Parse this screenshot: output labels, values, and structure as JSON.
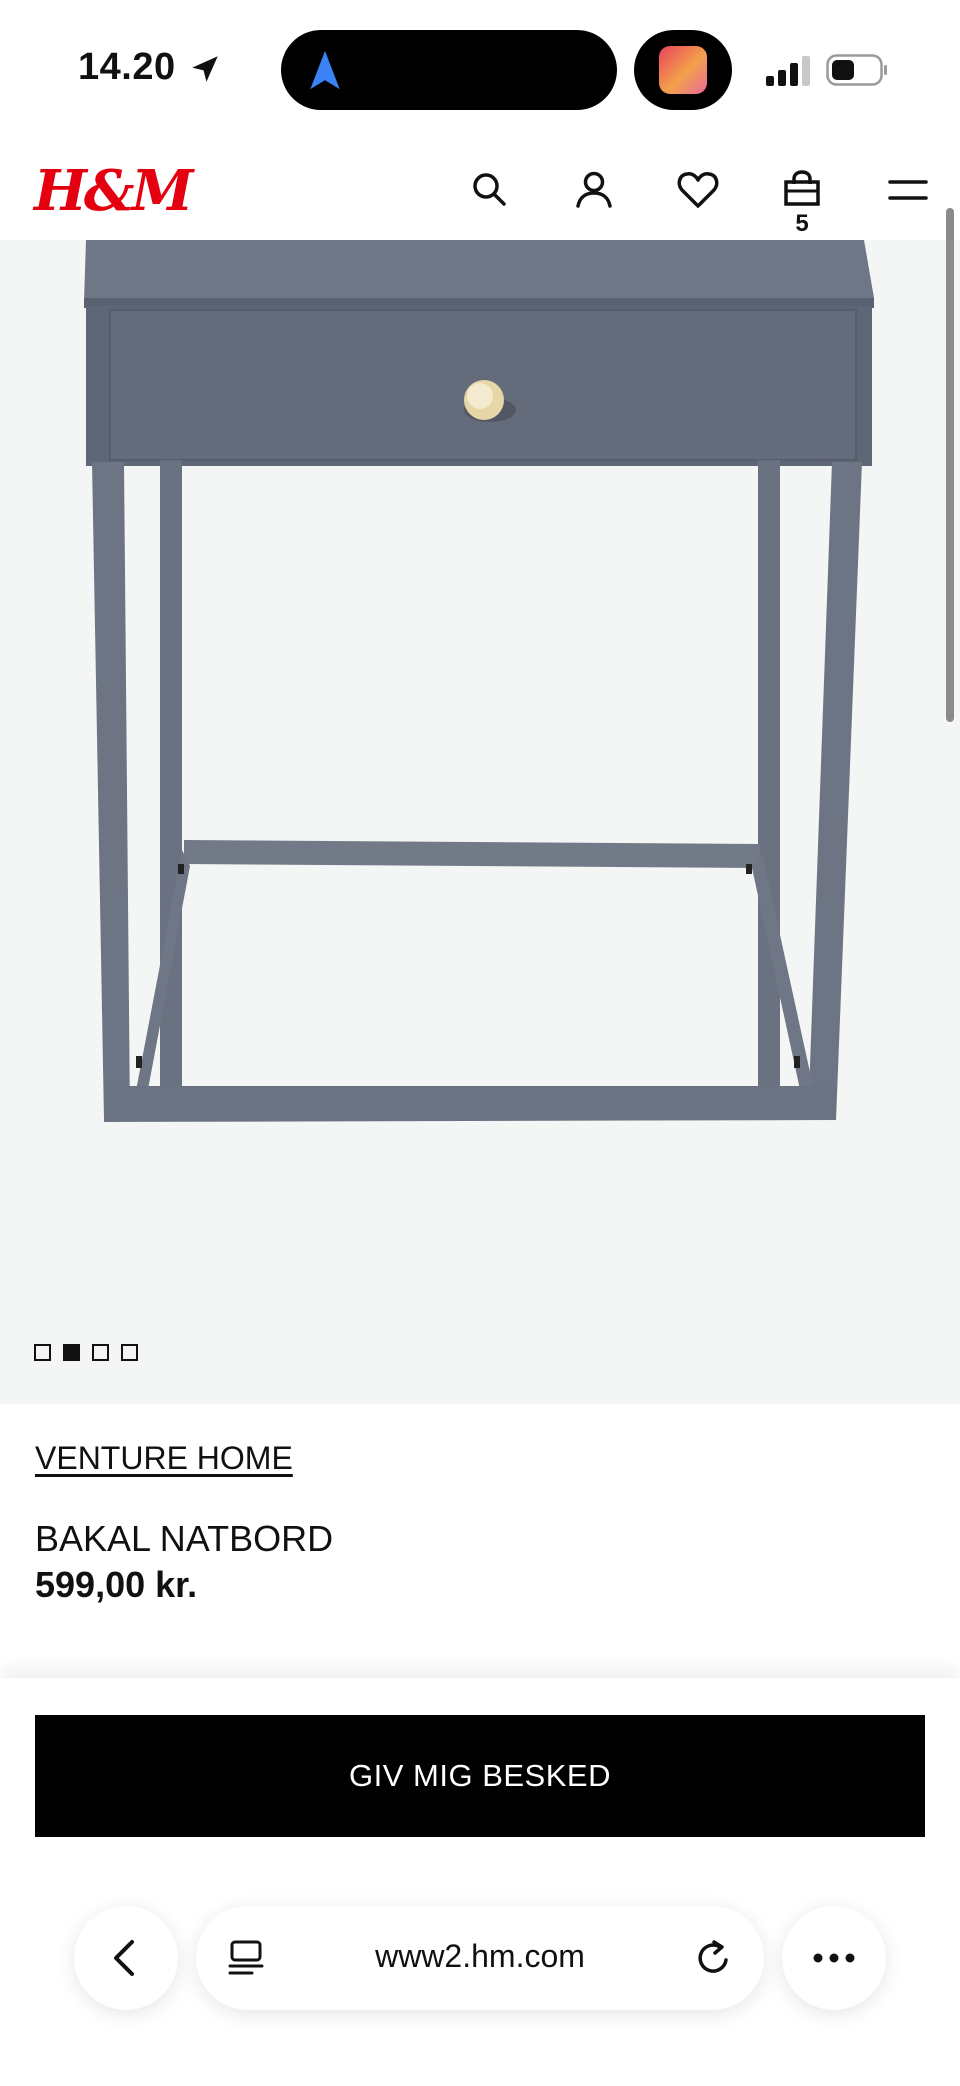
{
  "status_bar": {
    "time": "14.20",
    "location_icon": "location-arrow-icon",
    "island_nav_icon": "navigation-arrow-icon",
    "island_app_icon": "app-thumbnail-icon",
    "signal_icon": "cellular-signal-icon",
    "battery_icon": "battery-icon"
  },
  "header": {
    "logo_text": "H&M",
    "brand_color": "#e50010",
    "icons": [
      "search-icon",
      "account-icon",
      "heart-icon",
      "shopping-bag-icon",
      "menu-icon"
    ],
    "cart_count": "5"
  },
  "gallery": {
    "image_subject": "grey metal bedside table with drawer and brass knob",
    "image_count": 4,
    "active_index": 1
  },
  "product": {
    "brand": "VENTURE HOME",
    "name": "BAKAL NATBORD",
    "price": "599,00 kr."
  },
  "actions": {
    "notify_label": "GIV MIG BESKED"
  },
  "browser": {
    "url": "www2.hm.com",
    "icons": [
      "back-chevron-icon",
      "tabs-icon",
      "reload-icon",
      "more-icon"
    ]
  }
}
